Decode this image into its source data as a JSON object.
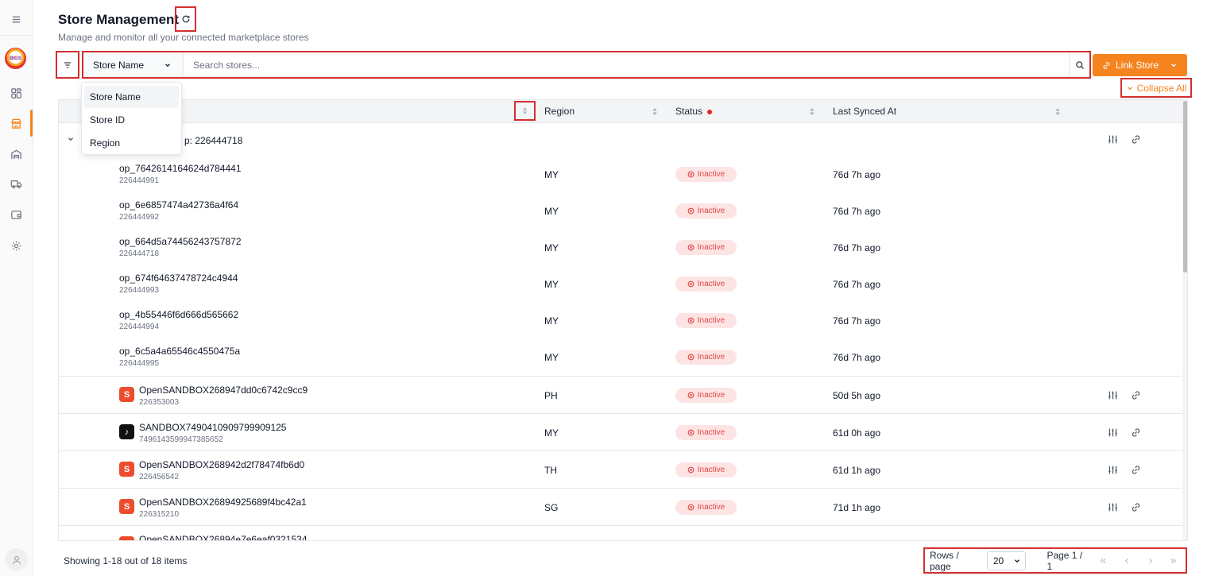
{
  "header": {
    "title": "Store Management",
    "subtitle": "Manage and monitor all your connected marketplace stores"
  },
  "search": {
    "field_selected": "Store Name",
    "placeholder": "Search stores...",
    "field_options": [
      "Store Name",
      "Store ID",
      "Region"
    ]
  },
  "actions": {
    "link_store": "Link Store",
    "collapse_all": "Collapse All"
  },
  "table": {
    "columns": [
      "Region",
      "Status",
      "Last Synced At"
    ],
    "group_label": "p: 226444718",
    "group_rows": [
      {
        "name": "op_7642614164624d784441",
        "id": "226444991",
        "region": "MY",
        "status": "Inactive",
        "synced": "76d 7h ago"
      },
      {
        "name": "op_6e6857474a42736a4f64",
        "id": "226444992",
        "region": "MY",
        "status": "Inactive",
        "synced": "76d 7h ago"
      },
      {
        "name": "op_664d5a74456243757872",
        "id": "226444718",
        "region": "MY",
        "status": "Inactive",
        "synced": "76d 7h ago"
      },
      {
        "name": "op_674f64637478724c4944",
        "id": "226444993",
        "region": "MY",
        "status": "Inactive",
        "synced": "76d 7h ago"
      },
      {
        "name": "op_4b55446f6d666d565662",
        "id": "226444994",
        "region": "MY",
        "status": "Inactive",
        "synced": "76d 7h ago"
      },
      {
        "name": "op_6c5a4a65546c4550475a",
        "id": "226444995",
        "region": "MY",
        "status": "Inactive",
        "synced": "76d 7h ago"
      }
    ],
    "store_rows": [
      {
        "platform": "shopee",
        "name": "OpenSANDBOX268947dd0c6742c9cc9",
        "id": "226353003",
        "region": "PH",
        "status": "Inactive",
        "synced": "50d 5h ago"
      },
      {
        "platform": "tiktok",
        "name": "SANDBOX7490410909799909125",
        "id": "7496143599947385652",
        "region": "MY",
        "status": "Inactive",
        "synced": "61d 0h ago"
      },
      {
        "platform": "shopee",
        "name": "OpenSANDBOX268942d2f78474fb6d0",
        "id": "226456542",
        "region": "TH",
        "status": "Inactive",
        "synced": "61d 1h ago"
      },
      {
        "platform": "shopee",
        "name": "OpenSANDBOX26894925689f4bc42a1",
        "id": "226315210",
        "region": "SG",
        "status": "Inactive",
        "synced": "71d 1h ago"
      },
      {
        "platform": "shopee",
        "name": "OpenSANDBOX26894e7e6eaf0321534",
        "id": "",
        "region": "",
        "status": "",
        "synced": ""
      }
    ]
  },
  "footer": {
    "showing": "Showing 1-18 out of 18 items",
    "rows_per_page_label": "Rows / page",
    "rows_per_page": "20",
    "page_info": "Page 1 / 1"
  },
  "colors": {
    "accent": "#f5841f",
    "inactive_text": "#e24545",
    "inactive_bg": "#fde4e4",
    "highlight_box": "#d32f2f"
  }
}
